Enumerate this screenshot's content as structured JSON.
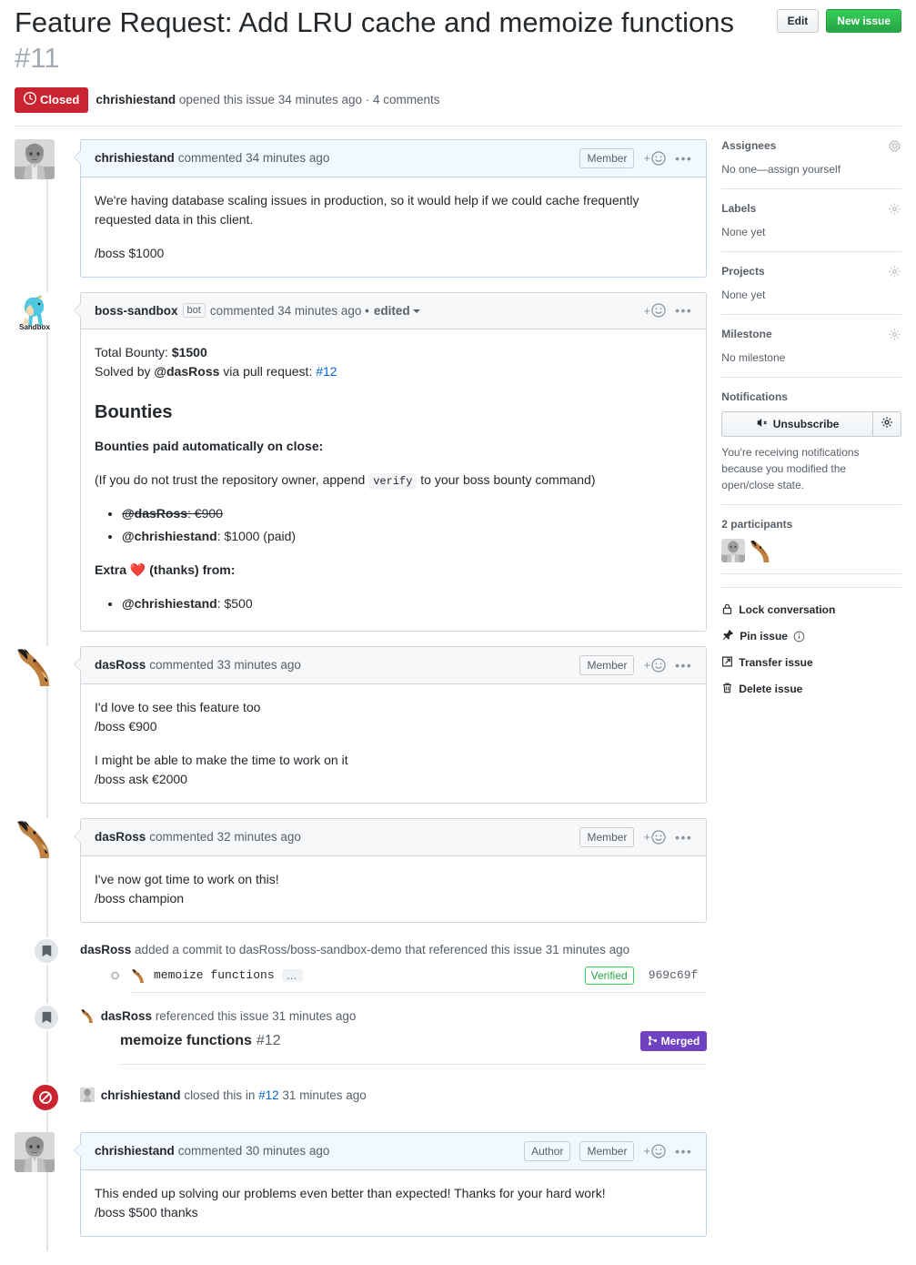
{
  "header": {
    "title": "Feature Request: Add LRU cache and memoize functions",
    "number": "#11",
    "edit_label": "Edit",
    "new_issue_label": "New issue",
    "state": "Closed",
    "meta_author": "chrishiestand",
    "meta_text": "opened this issue 34 minutes ago · 4 comments"
  },
  "comments": [
    {
      "author": "chrishiestand",
      "headtext": "commented 34 minutes ago",
      "badges": [
        "Member"
      ],
      "is_author_theme": true,
      "body_p1": "We're having database scaling issues in production, so it would help if we could cache frequently requested data in this client.",
      "body_p2": "/boss $1000"
    },
    {
      "author": "boss-sandbox",
      "bot_tag": "bot",
      "headtext": "commented 34 minutes ago •",
      "edited_label": "edited",
      "total_bounty_label": "Total Bounty:",
      "total_bounty_value": "$1500",
      "solved_prefix": "Solved by",
      "solved_user": "@dasRoss",
      "solved_mid": "via pull request:",
      "solved_pr": "#12",
      "heading": "Bounties",
      "paid_label": "Bounties paid automatically on close:",
      "verify_pre": "(If you do not trust the repository owner, append",
      "verify_code": "verify",
      "verify_post": "to your boss bounty command)",
      "paid_items": [
        {
          "user": "@dasRoss",
          "amount": ": €900",
          "struck": true
        },
        {
          "user": "@chrishiestand",
          "amount": ": $1000 (paid)",
          "struck": false
        }
      ],
      "extra_pre": "Extra",
      "extra_emoji": "❤️",
      "extra_post": "(thanks) from:",
      "extra_items": [
        {
          "user": "@chrishiestand",
          "amount": ": $500"
        }
      ]
    },
    {
      "author": "dasRoss",
      "headtext": "commented 33 minutes ago",
      "badges": [
        "Member"
      ],
      "body_p1_l1": "I'd love to see this feature too",
      "body_p1_l2": "/boss €900",
      "body_p2_l1": "I might be able to make the time to work on it",
      "body_p2_l2": "/boss ask €2000"
    },
    {
      "author": "dasRoss",
      "headtext": "commented 32 minutes ago",
      "badges": [
        "Member"
      ],
      "body_l1": "I've now got time to work on this!",
      "body_l2": "/boss champion"
    },
    {
      "author": "chrishiestand",
      "headtext": "commented 30 minutes ago",
      "badges": [
        "Author",
        "Member"
      ],
      "is_author_theme": true,
      "body_l1": "This ended up solving our problems even better than expected! Thanks for your hard work!",
      "body_l2": "/boss $500 thanks"
    }
  ],
  "events": {
    "commit_event": {
      "actor": "dasRoss",
      "text": "added a commit to dasRoss/boss-sandbox-demo that referenced this issue 31 minutes ago",
      "commit_message": "memoize functions",
      "more": "…",
      "verified": "Verified",
      "sha": "969c69f"
    },
    "reference_event": {
      "actor": "dasRoss",
      "text": "referenced this issue 31 minutes ago",
      "ref_title": "memoize functions",
      "ref_number": "#12",
      "merged_label": "Merged"
    },
    "closed_event": {
      "actor": "chrishiestand",
      "pre": "closed this in",
      "link": "#12",
      "post": "31 minutes ago"
    }
  },
  "sidebar": {
    "sections": [
      {
        "title": "Assignees",
        "value": "No one—assign yourself"
      },
      {
        "title": "Labels",
        "value": "None yet"
      },
      {
        "title": "Projects",
        "value": "None yet"
      },
      {
        "title": "Milestone",
        "value": "No milestone"
      }
    ],
    "notifications": {
      "title": "Notifications",
      "button_label": "Unsubscribe",
      "description": "You're receiving notifications because you modified the open/close state."
    },
    "participants": {
      "title": "2 participants"
    },
    "actions": [
      {
        "label": "Lock conversation",
        "icon": "lock-icon"
      },
      {
        "label": "Pin issue",
        "icon": "pin-icon",
        "info": true
      },
      {
        "label": "Transfer issue",
        "icon": "transfer-icon"
      },
      {
        "label": "Delete issue",
        "icon": "trash-icon"
      }
    ]
  },
  "colors": {
    "closed_red": "#cb2431",
    "green": "#28a745",
    "link_blue": "#0366d6",
    "merged_purple": "#6f42c1"
  }
}
